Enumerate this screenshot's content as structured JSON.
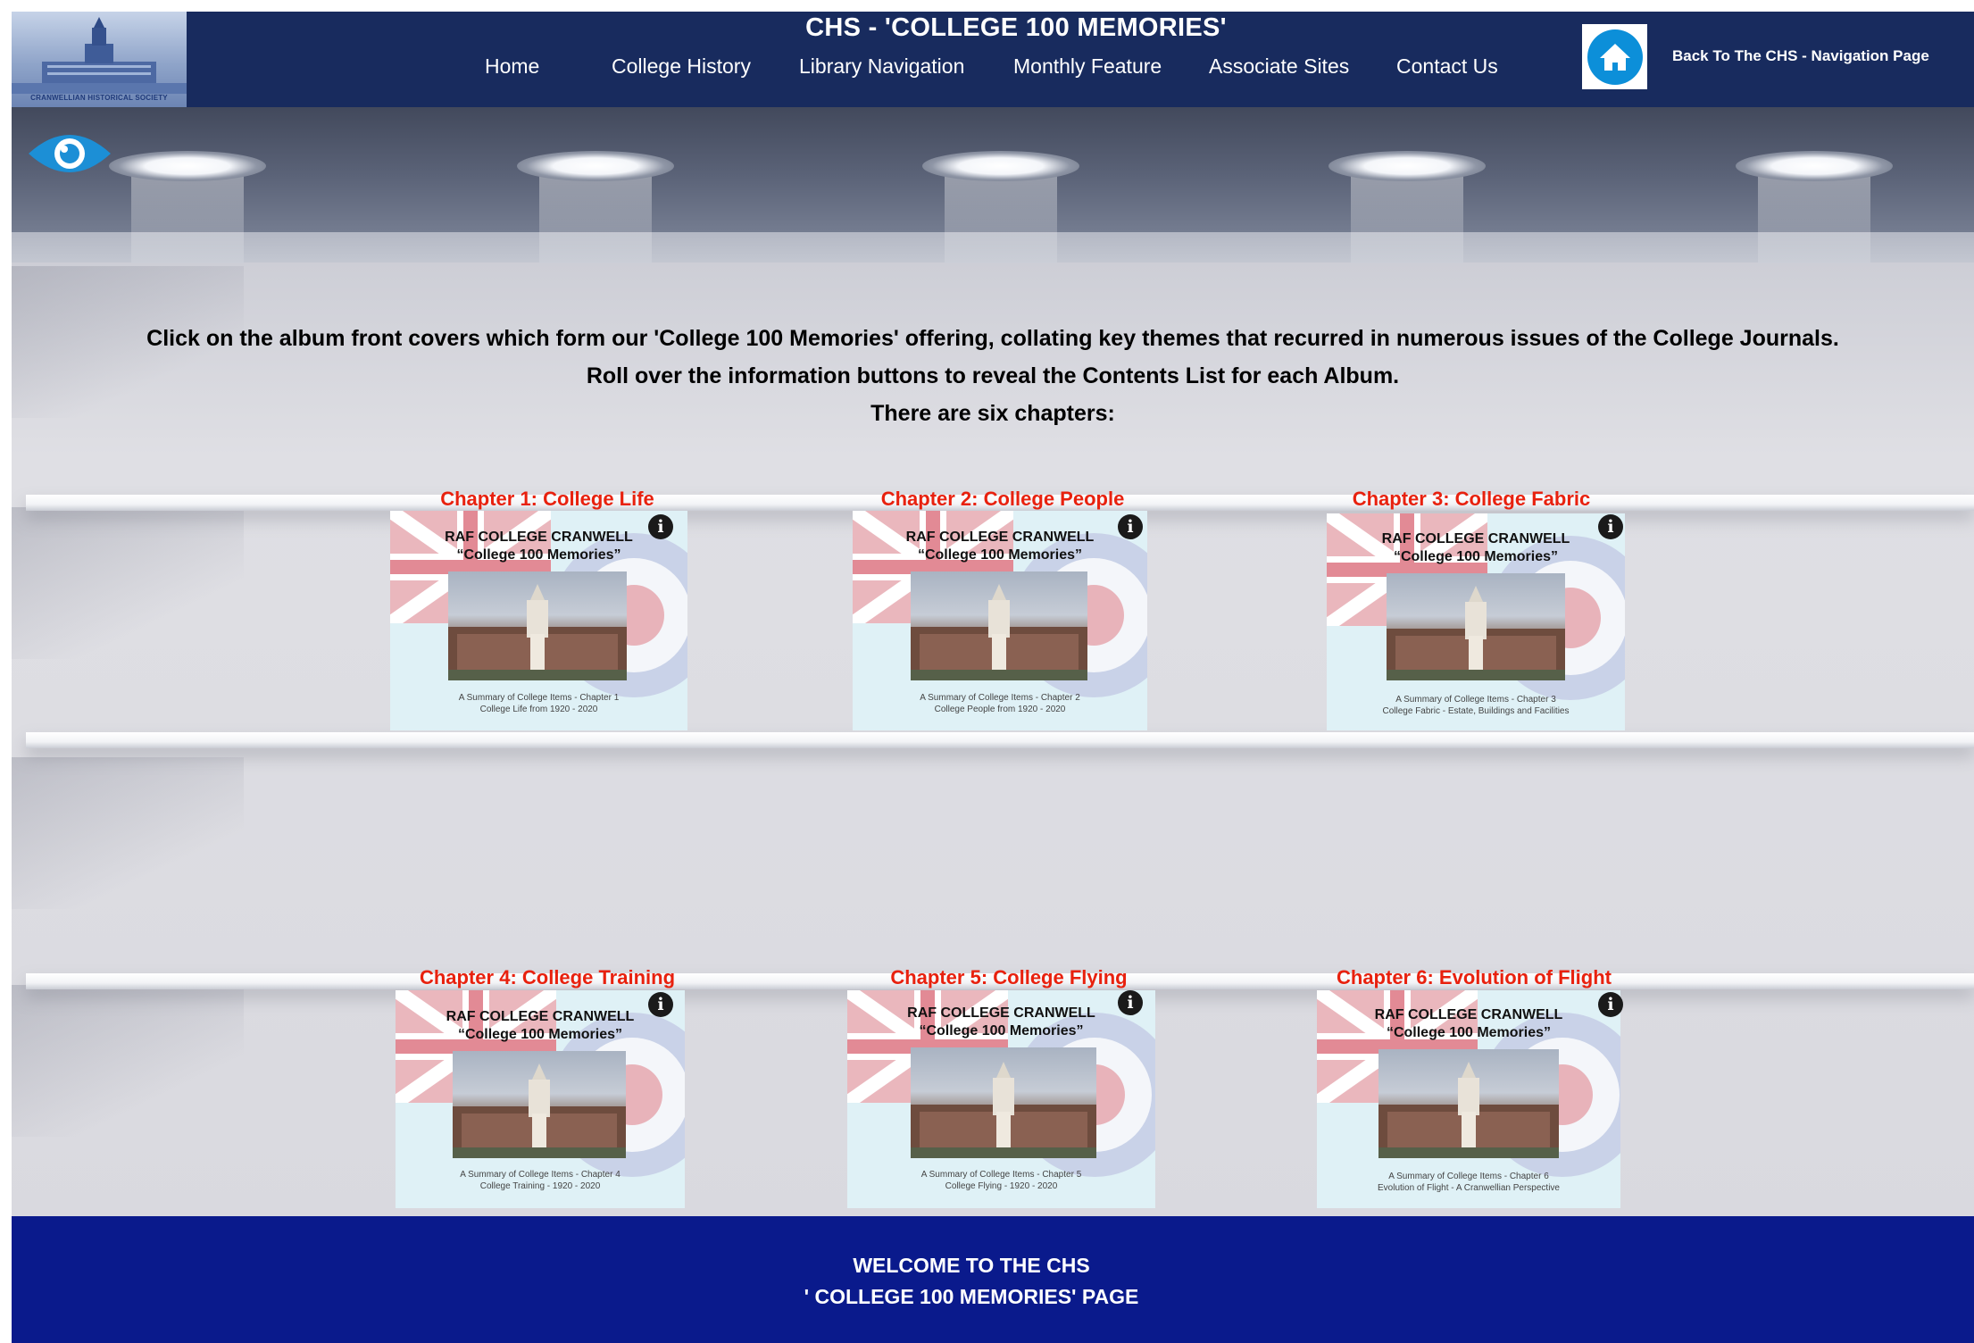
{
  "header": {
    "logo_text": "CRANWELLIAN HISTORICAL SOCIETY",
    "title": "CHS - 'COLLEGE 100  MEMORIES'",
    "nav": [
      {
        "label": "Home"
      },
      {
        "label": "College History"
      },
      {
        "label": "Library Navigation"
      },
      {
        "label": "Monthly Feature"
      },
      {
        "label": "Associate Sites"
      },
      {
        "label": "Contact Us"
      }
    ],
    "home_icon": "home-icon",
    "back_link": "Back To The CHS - Navigation Page"
  },
  "intro": {
    "line1": "Click on the album front covers which form our 'College 100 Memories' offering, collating key themes that recurred in numerous issues of the College Journals.",
    "line2": "Roll over the information buttons to reveal the Contents List for each Album.",
    "line3": "There are six chapters:"
  },
  "chapters": [
    {
      "title": "Chapter 1: College Life",
      "heading1": "RAF COLLEGE CRANWELL",
      "heading2": "“College 100 Memories”",
      "caption1": "A Summary of College Items - Chapter 1",
      "caption2": "College Life from 1920 - 2020"
    },
    {
      "title": "Chapter 2: College People",
      "heading1": "RAF COLLEGE CRANWELL",
      "heading2": "“College 100 Memories”",
      "caption1": "A Summary of College Items - Chapter 2",
      "caption2": "College People from 1920 - 2020"
    },
    {
      "title": "Chapter 3: College Fabric",
      "heading1": "RAF COLLEGE CRANWELL",
      "heading2": "“College 100 Memories”",
      "caption1": "A Summary of College Items - Chapter 3",
      "caption2": "College Fabric - Estate, Buildings and Facilities"
    },
    {
      "title": "Chapter 4: College Training",
      "heading1": "RAF COLLEGE CRANWELL",
      "heading2": "“College 100 Memories”",
      "caption1": "A Summary of College Items - Chapter 4",
      "caption2": "College Training - 1920 - 2020"
    },
    {
      "title": "Chapter 5: College Flying",
      "heading1": "RAF COLLEGE CRANWELL",
      "heading2": "“College 100 Memories”",
      "caption1": "A Summary of College Items - Chapter 5",
      "caption2": "College Flying - 1920 - 2020"
    },
    {
      "title": "Chapter 6: Evolution of Flight",
      "heading1": "RAF COLLEGE CRANWELL",
      "heading2": "“College 100 Memories”",
      "caption1": "A Summary of College Items - Chapter 6",
      "caption2": "Evolution of Flight - A Cranwellian Perspective"
    }
  ],
  "info_icon_label": "i",
  "footer": {
    "line1": "WELCOME TO  THE CHS",
    "line2": "' COLLEGE 100 MEMORIES' PAGE"
  },
  "colors": {
    "header_bg": "#182b5e",
    "chapter_title": "#e8210e",
    "footer_bg": "#0a1a8c",
    "home_button": "#0c8fd9",
    "eye_icon": "#1c8fd6"
  }
}
